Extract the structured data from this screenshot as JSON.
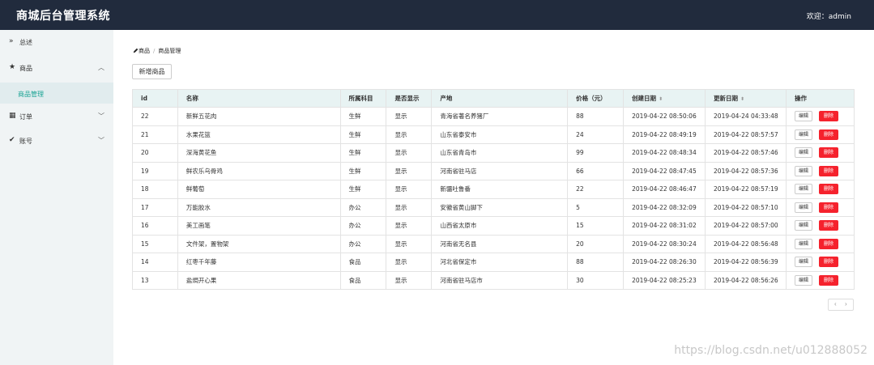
{
  "header": {
    "title": "商城后台管理系统",
    "welcome": "欢迎：admin"
  },
  "sidebar": {
    "items": [
      {
        "label": "总述",
        "icon": "chevrons-right-icon",
        "glyph": "»"
      },
      {
        "label": "商品",
        "icon": "star-icon",
        "glyph": "★",
        "chevron": "︿"
      },
      {
        "label": "订单",
        "icon": "grid-icon",
        "glyph": "▦",
        "chevron": "﹀"
      },
      {
        "label": "账号",
        "icon": "check-circle-icon",
        "glyph": "✔",
        "chevron": "﹀"
      }
    ],
    "sub_item": "商品管理"
  },
  "breadcrumb": {
    "first": "商品",
    "second": "商品管理"
  },
  "toolbar": {
    "add_label": "新增商品"
  },
  "table": {
    "columns": [
      "id",
      "名称",
      "所属科目",
      "是否显示",
      "产地",
      "价格（元）",
      "创建日期",
      "更新日期",
      "操作"
    ],
    "edit_label": "编辑",
    "delete_label": "删除",
    "rows": [
      [
        "22",
        "新鲜五花肉",
        "生鲜",
        "显示",
        "青海省著名养猪厂",
        "88",
        "2019-04-22 08:50:06",
        "2019-04-24 04:33:48"
      ],
      [
        "21",
        "水果花篮",
        "生鲜",
        "显示",
        "山东省泰安市",
        "24",
        "2019-04-22 08:49:19",
        "2019-04-22 08:57:57"
      ],
      [
        "20",
        "深海黄花鱼",
        "生鲜",
        "显示",
        "山东省青岛市",
        "99",
        "2019-04-22 08:48:34",
        "2019-04-22 08:57:46"
      ],
      [
        "19",
        "鲜农乐乌骨鸡",
        "生鲜",
        "显示",
        "河南省驻马店",
        "66",
        "2019-04-22 08:47:45",
        "2019-04-22 08:57:36"
      ],
      [
        "18",
        "鲜葡萄",
        "生鲜",
        "显示",
        "新疆吐鲁番",
        "22",
        "2019-04-22 08:46:47",
        "2019-04-22 08:57:19"
      ],
      [
        "17",
        "万能胶水",
        "办公",
        "显示",
        "安徽省黄山脚下",
        "5",
        "2019-04-22 08:32:09",
        "2019-04-22 08:57:10"
      ],
      [
        "16",
        "美工画笔",
        "办公",
        "显示",
        "山西省太原市",
        "15",
        "2019-04-22 08:31:02",
        "2019-04-22 08:57:00"
      ],
      [
        "15",
        "文件架，置物架",
        "办公",
        "显示",
        "河南省无名县",
        "20",
        "2019-04-22 08:30:24",
        "2019-04-22 08:56:48"
      ],
      [
        "14",
        "红枣千年藤",
        "食品",
        "显示",
        "河北省保定市",
        "88",
        "2019-04-22 08:26:30",
        "2019-04-22 08:56:39"
      ],
      [
        "13",
        "盐焗开心果",
        "食品",
        "显示",
        "河南省驻马店市",
        "30",
        "2019-04-22 08:25:23",
        "2019-04-22 08:56:26"
      ]
    ]
  },
  "pager": {
    "prev": "‹",
    "next": "›"
  },
  "watermark": "https://blog.csdn.net/u012888052"
}
